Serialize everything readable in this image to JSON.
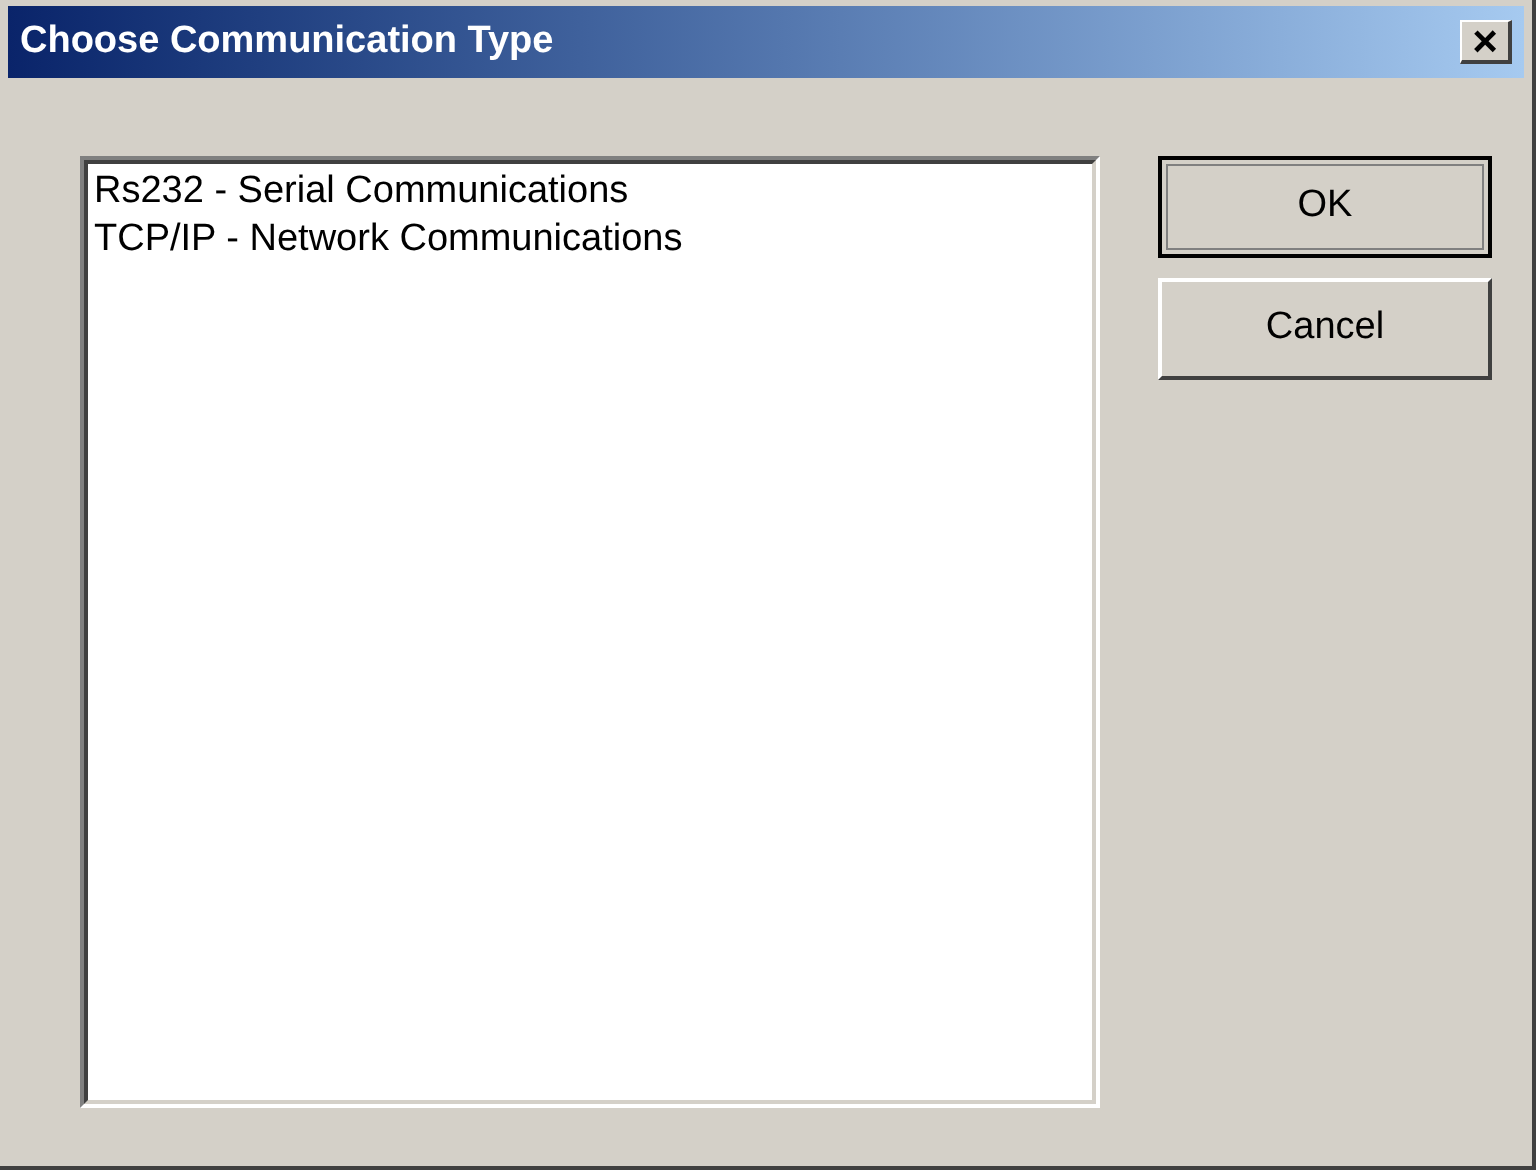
{
  "window": {
    "title": "Choose Communication Type",
    "close": "×"
  },
  "list": {
    "items": [
      {
        "label": "Rs232 - Serial Communications"
      },
      {
        "label": "TCP/IP - Network Communications"
      }
    ]
  },
  "buttons": [
    {
      "label": "OK"
    },
    {
      "label": "Cancel"
    }
  ]
}
